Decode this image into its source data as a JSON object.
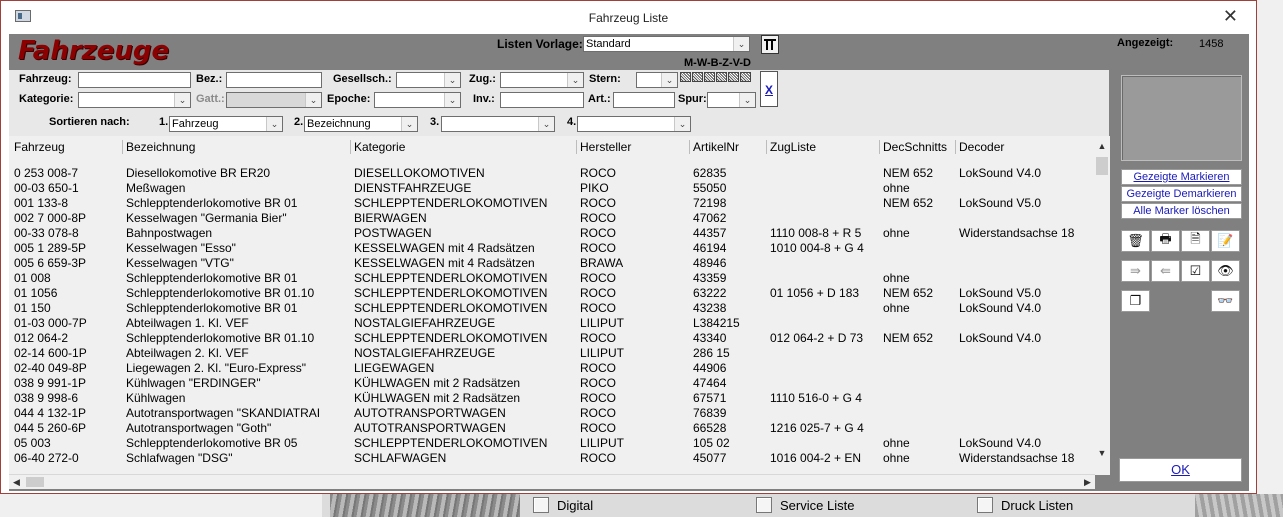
{
  "window": {
    "title": "Fahrzeug Liste",
    "close_glyph": "✕"
  },
  "header": {
    "app_title": "Fahrzeuge",
    "listen_vorlage_label": "Listen Vorlage:",
    "listen_vorlage_value": "Standard",
    "angezeigt_label": "Angezeigt:",
    "angezeigt_value": "1458",
    "mwbzvd": "M-W-B-Z-V-D"
  },
  "filters": {
    "fahrzeug": "Fahrzeug:",
    "bez": "Bez.:",
    "gesellsch": "Gesellsch.:",
    "zug": "Zug.:",
    "stern": "Stern:",
    "kategorie": "Kategorie:",
    "gatt": "Gatt.:",
    "epoche": "Epoche:",
    "inv": "Inv.:",
    "art": "Art.:",
    "spur": "Spur:",
    "clear": "X"
  },
  "sort": {
    "label": "Sortieren nach:",
    "n1": "1.",
    "v1": "Fahrzeug",
    "n2": "2.",
    "v2": "Bezeichnung",
    "n3": "3.",
    "v3": "",
    "n4": "4.",
    "v4": ""
  },
  "columns": [
    "Fahrzeug",
    "Bezeichnung",
    "Kategorie",
    "Hersteller",
    "ArtikelNr",
    "ZugListe",
    "DecSchnitts",
    "Decoder"
  ],
  "rows": [
    [
      "0 253 008-7",
      "Diesellokomotive BR ER20",
      "DIESELLOKOMOTIVEN",
      "ROCO",
      "62835",
      "",
      "NEM 652",
      "LokSound V4.0"
    ],
    [
      "00-03 650-1",
      "Meßwagen",
      "DIENSTFAHRZEUGE",
      "PIKO",
      "55050",
      "",
      "ohne",
      ""
    ],
    [
      "001 133-8",
      "Schlepptenderlokomotive BR 01",
      "SCHLEPPTENDERLOKOMOTIVEN",
      "ROCO",
      "72198",
      "",
      "NEM 652",
      "LokSound V5.0"
    ],
    [
      "002 7 000-8P",
      "Kesselwagen \"Germania Bier\"",
      "BIERWAGEN",
      "ROCO",
      "47062",
      "",
      "",
      ""
    ],
    [
      "00-33 078-8",
      "Bahnpostwagen",
      "POSTWAGEN",
      "ROCO",
      "44357",
      "1110 008-8 + R 5",
      "ohne",
      "Widerstandsachse 18"
    ],
    [
      "005 1 289-5P",
      "Kesselwagen \"Esso\"",
      "KESSELWAGEN mit 4 Radsätzen",
      "ROCO",
      "46194",
      "1010 004-8 + G 4",
      "",
      ""
    ],
    [
      "005 6 659-3P",
      "Kesselwagen \"VTG\"",
      "KESSELWAGEN mit 4 Radsätzen",
      "BRAWA",
      "48946",
      "",
      "",
      ""
    ],
    [
      "01 008",
      "Schlepptenderlokomotive BR 01",
      "SCHLEPPTENDERLOKOMOTIVEN",
      "ROCO",
      "43359",
      "",
      "ohne",
      ""
    ],
    [
      "01 1056",
      "Schlepptenderlokomotive BR 01.10",
      "SCHLEPPTENDERLOKOMOTIVEN",
      "ROCO",
      "63222",
      "01 1056 + D 183",
      "NEM 652",
      "LokSound V5.0"
    ],
    [
      "01 150",
      "Schlepptenderlokomotive BR 01",
      "SCHLEPPTENDERLOKOMOTIVEN",
      "ROCO",
      "43238",
      "",
      "ohne",
      "LokSound V4.0"
    ],
    [
      "01-03 000-7P",
      "Abteilwagen 1. Kl. VEF",
      "NOSTALGIEFAHRZEUGE",
      "LILIPUT",
      "L384215",
      "",
      "",
      ""
    ],
    [
      "012 064-2",
      "Schlepptenderlokomotive BR 01.10",
      "SCHLEPPTENDERLOKOMOTIVEN",
      "ROCO",
      "43340",
      "012 064-2 + D 73",
      "NEM 652",
      "LokSound V4.0"
    ],
    [
      "02-14 600-1P",
      "Abteilwagen 2. Kl. VEF",
      "NOSTALGIEFAHRZEUGE",
      "LILIPUT",
      "286 15",
      "",
      "",
      ""
    ],
    [
      "02-40 049-8P",
      "Liegewagen 2. Kl. \"Euro-Express\"",
      "LIEGEWAGEN",
      "ROCO",
      "44906",
      "",
      "",
      ""
    ],
    [
      "038 9 991-1P",
      "Kühlwagen \"ERDINGER\"",
      "KÜHLWAGEN mit 2 Radsätzen",
      "ROCO",
      "47464",
      "",
      "",
      ""
    ],
    [
      "038 9 998-6",
      "Kühlwagen",
      "KÜHLWAGEN mit 2 Radsätzen",
      "ROCO",
      "67571",
      "1110 516-0 + G 4",
      "",
      ""
    ],
    [
      "044 4 132-1P",
      "Autotransportwagen \"SKANDIATRAI",
      "AUTOTRANSPORTWAGEN",
      "ROCO",
      "76839",
      "",
      "",
      ""
    ],
    [
      "044 5 260-6P",
      "Autotransportwagen \"Goth\"",
      "AUTOTRANSPORTWAGEN",
      "ROCO",
      "66528",
      "1216 025-7 + G 4",
      "",
      ""
    ],
    [
      "05 003",
      "Schlepptenderlokomotive BR 05",
      "SCHLEPPTENDERLOKOMOTIVEN",
      "LILIPUT",
      "105 02",
      "",
      "ohne",
      "LokSound V4.0"
    ],
    [
      "06-40 272-0",
      "Schlafwagen \"DSG\"",
      "SCHLAFWAGEN",
      "ROCO",
      "45077",
      "1016 004-2 + EN",
      "ohne",
      "Widerstandsachse 18"
    ]
  ],
  "side": {
    "mark_shown": "Gezeigte Markieren",
    "unmark_shown": "Gezeigte Demarkieren",
    "clear_marks": "Alle Marker löschen",
    "ok": "OK"
  },
  "background": {
    "digital": "Digital",
    "service": "Service Liste",
    "druck": "Druck Listen"
  }
}
